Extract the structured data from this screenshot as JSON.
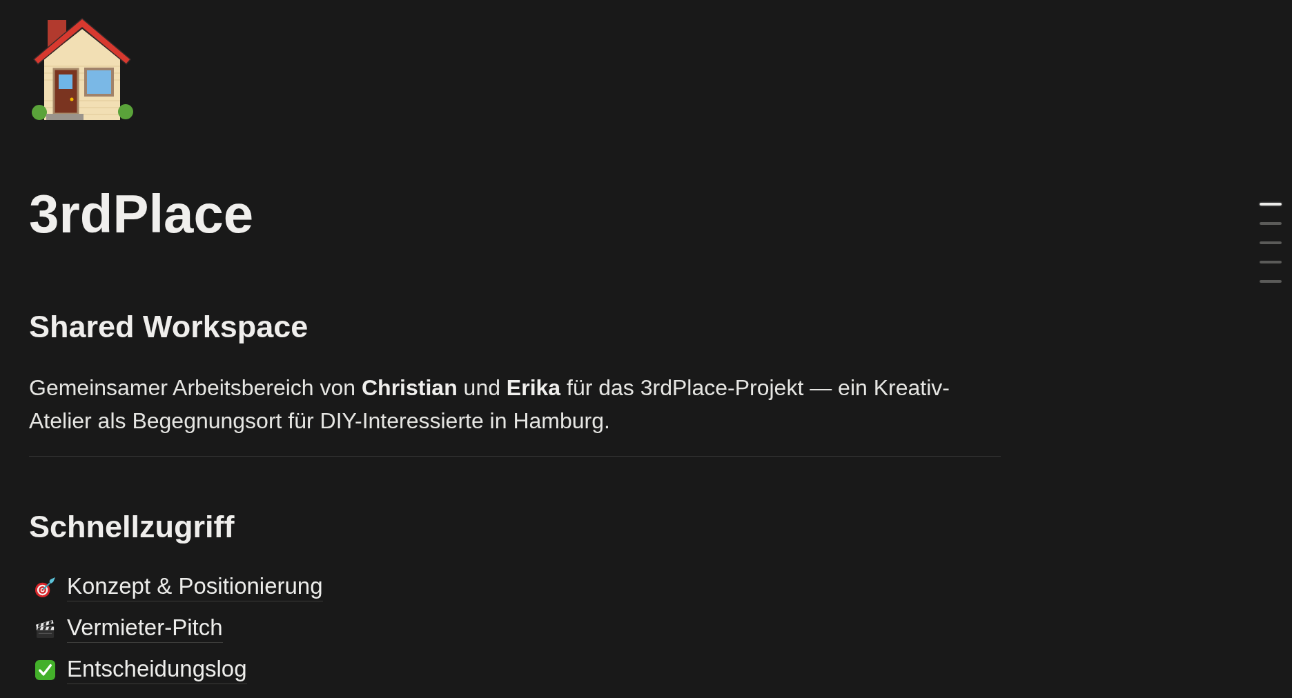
{
  "title": "3rdPlace",
  "outline": [
    {
      "selected": true
    },
    {
      "selected": false
    },
    {
      "selected": false
    },
    {
      "selected": false
    },
    {
      "selected": false
    }
  ],
  "intro": {
    "heading": "Shared Workspace",
    "text": "Gemeinsamer Arbeitsbereich von **Christian** und **Erika** für das 3rdPlace-Projekt — ein Kreativ-Atelier als Begegnungsort für DIY-Interessierte in Hamburg."
  },
  "quick_access": {
    "heading": "Schnellzugriff",
    "links": [
      {
        "label": "Konzept & Positionierung"
      },
      {
        "label": "Vermieter-Pitch"
      },
      {
        "label": "Entscheidungslog"
      }
    ]
  }
}
